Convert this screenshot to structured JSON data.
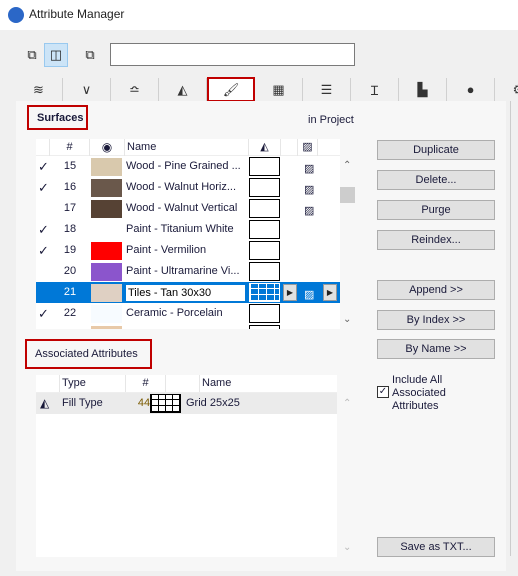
{
  "window": {
    "title": "Attribute Manager"
  },
  "toolbar": {
    "view_buttons": [
      "left-pane-view-icon",
      "dual-pane-view-icon",
      "right-pane-view-icon"
    ],
    "selected_view": 1,
    "search_value": ""
  },
  "tabs": [
    {
      "icon": "layers-icon"
    },
    {
      "icon": "pen-icon"
    },
    {
      "icon": "line-type-icon"
    },
    {
      "icon": "fill-icon"
    },
    {
      "icon": "surface-brush-icon",
      "selected": true
    },
    {
      "icon": "building-material-icon"
    },
    {
      "icon": "composite-icon"
    },
    {
      "icon": "profile-icon"
    },
    {
      "icon": "zone-icon"
    },
    {
      "icon": "globe-icon"
    },
    {
      "icon": "mep-icon"
    }
  ],
  "surfaces": {
    "title": "Surfaces",
    "location": "in Project",
    "columns": [
      "#",
      "Name"
    ],
    "rows": [
      {
        "checked": true,
        "num": "15",
        "color": "#d9c9ad",
        "name": "Wood - Pine Grained ...",
        "texture": true
      },
      {
        "checked": true,
        "num": "16",
        "color": "#6a584b",
        "name": "Wood - Walnut Horiz...",
        "texture": true
      },
      {
        "checked": false,
        "num": "17",
        "color": "#564234",
        "name": "Wood - Walnut Vertical",
        "texture": true
      },
      {
        "checked": true,
        "num": "18",
        "color": "#ffffff",
        "name": "Paint - Titanium White",
        "texture": false
      },
      {
        "checked": true,
        "num": "19",
        "color": "#ff0000",
        "name": "Paint - Vermilion",
        "texture": false
      },
      {
        "checked": false,
        "num": "20",
        "color": "#8b55cc",
        "name": "Paint - Ultramarine Vi...",
        "texture": false
      },
      {
        "checked": false,
        "num": "21",
        "color": "#dfd0c3",
        "name": "Tiles - Tan 30x30",
        "texture": true,
        "selected": true
      },
      {
        "checked": true,
        "num": "22",
        "color": "#f7fbff",
        "name": "Ceramic - Porcelain",
        "texture": false
      },
      {
        "checked": true,
        "num": "",
        "color": "#e8c9a8",
        "name": "",
        "texture": false
      }
    ]
  },
  "buttons": {
    "duplicate": "Duplicate",
    "delete": "Delete...",
    "purge": "Purge",
    "reindex": "Reindex...",
    "append": "Append >>",
    "by_index": "By Index >>",
    "by_name": "By Name >>",
    "save_txt": "Save as TXT..."
  },
  "associated": {
    "title": "Associated Attributes",
    "columns": [
      "Type",
      "#",
      "Name"
    ],
    "rows": [
      {
        "type": "Fill Type",
        "num": "44",
        "name": "Grid 25x25"
      }
    ],
    "include_all_label": "Include All Associated Attributes",
    "include_all_checked": true
  },
  "colors": {
    "selection": "#0078d7",
    "highlight_box": "#c00000"
  }
}
